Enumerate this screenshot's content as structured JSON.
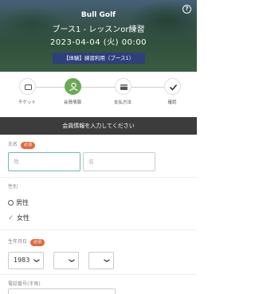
{
  "hero": {
    "title": "Bull Golf",
    "subtitle": "ブース1 - レッスンor練習",
    "datetime": "2023-04-04 (火) 00:00",
    "badge": "【体験】練習利用（ブース1）",
    "help": "?"
  },
  "steps": [
    {
      "label": "チケット",
      "icon": "ticket-icon",
      "active": false
    },
    {
      "label": "会員情報",
      "icon": "person-icon",
      "active": true
    },
    {
      "label": "支払方法",
      "icon": "card-icon",
      "active": false
    },
    {
      "label": "確認",
      "icon": "check-icon",
      "active": false
    }
  ],
  "banner": "会員情報を入力してください",
  "name_field": {
    "label": "氏名",
    "required": "必須",
    "last_placeholder": "姓",
    "first_placeholder": "名"
  },
  "gender_field": {
    "label": "性別",
    "options": [
      "男性",
      "女性"
    ],
    "selected": "女性"
  },
  "birth_field": {
    "label": "生年月日",
    "required": "必須",
    "year": "1983",
    "month": "",
    "day": ""
  },
  "phone_field": {
    "label": "電話番号(半角)"
  },
  "colors": {
    "accent": "#6aaa55",
    "badge": "#2e3f7c",
    "required": "#e26a3d",
    "banner": "#3c3c3c"
  }
}
